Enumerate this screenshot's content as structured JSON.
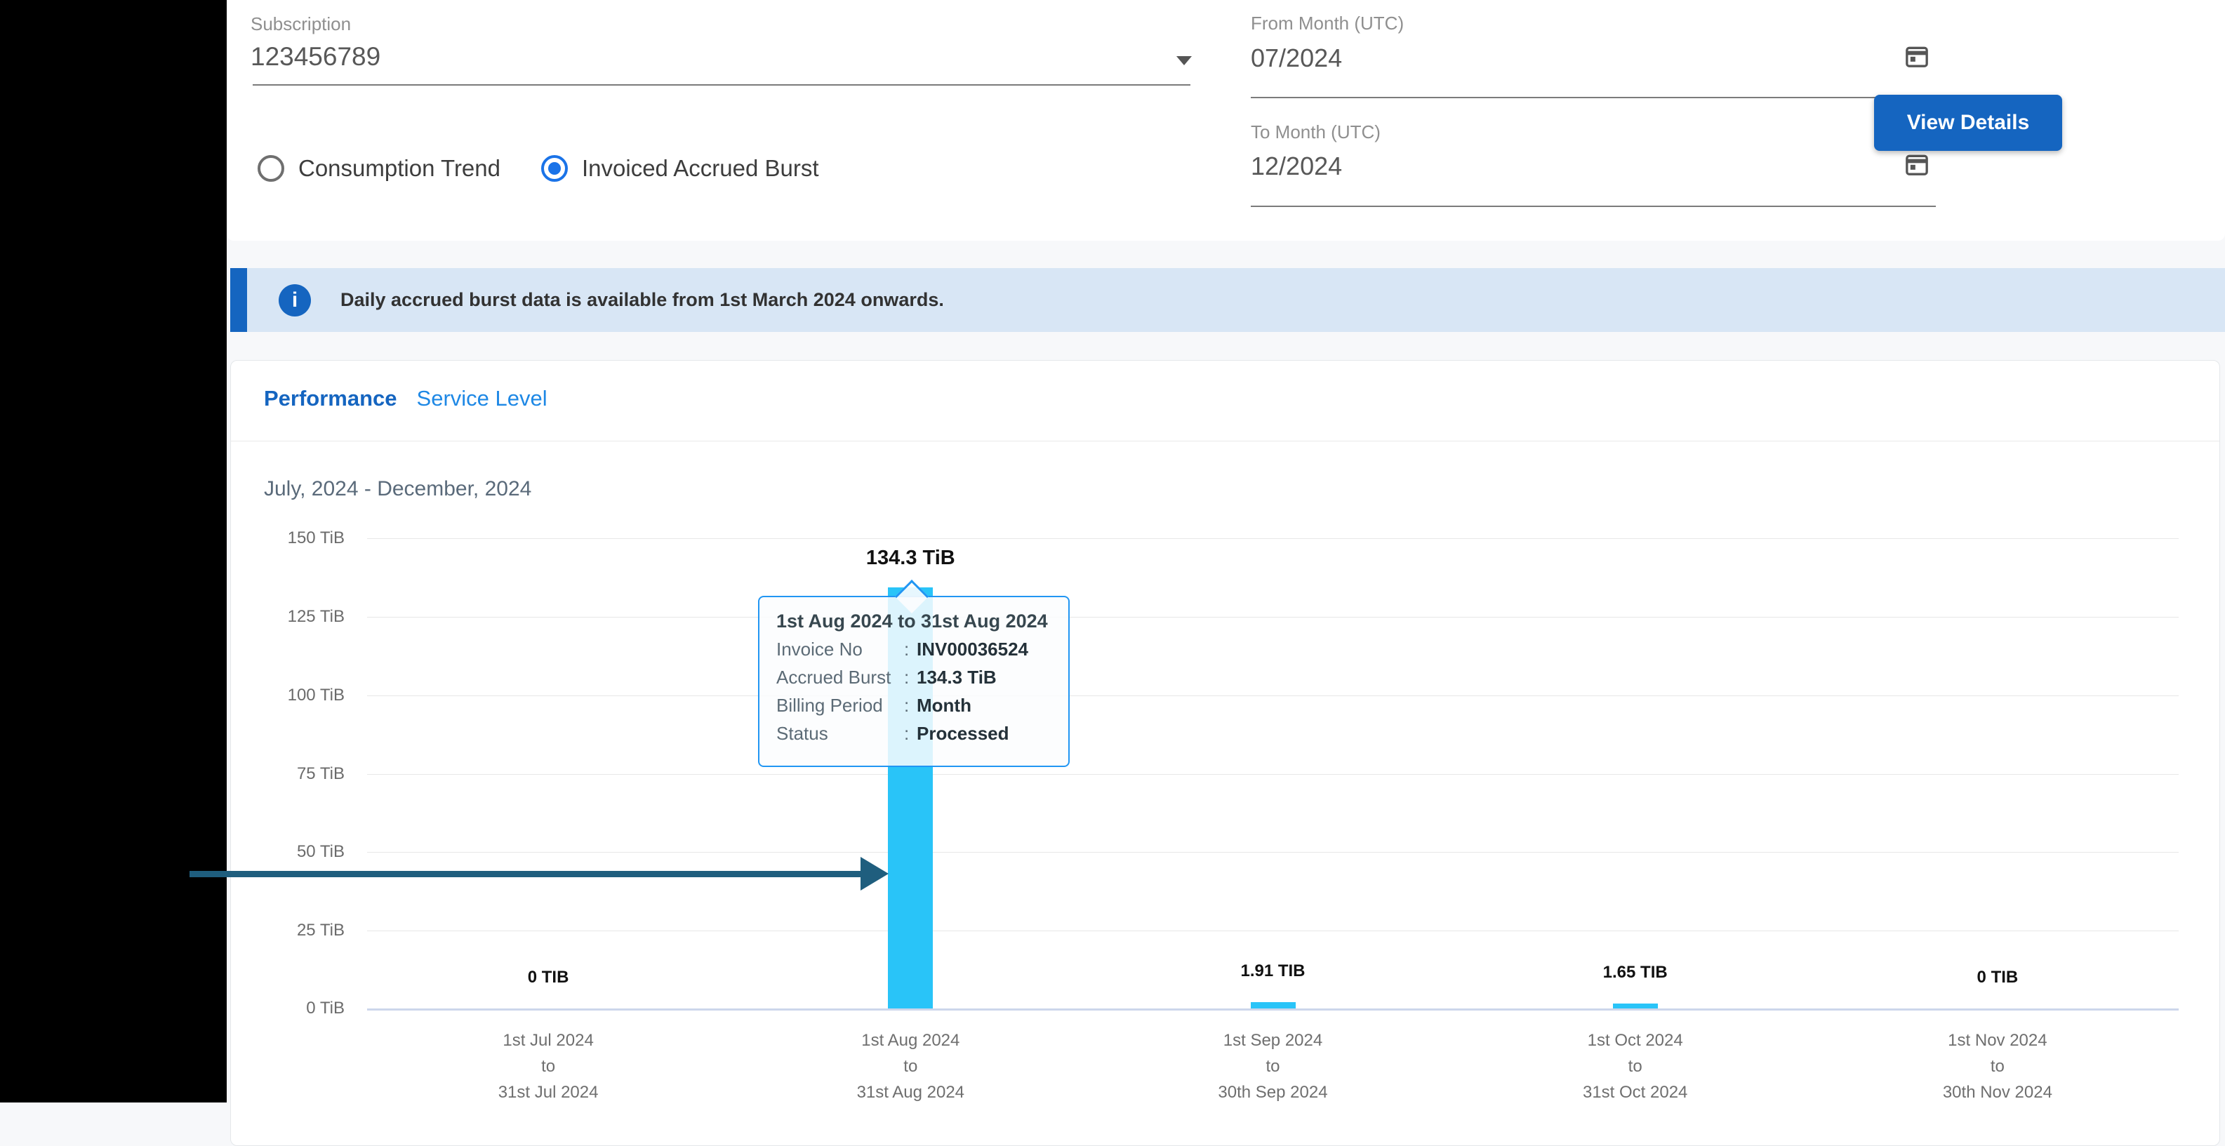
{
  "filters": {
    "subscription": {
      "label": "Subscription",
      "value": "123456789",
      "icon": "dropdown-arrow-icon"
    },
    "view_options": [
      {
        "label": "Consumption Trend",
        "selected": false
      },
      {
        "label": "Invoiced Accrued Burst",
        "selected": true
      }
    ],
    "from_month": {
      "label": "From Month (UTC)",
      "value": "07/2024",
      "icon": "calendar-icon"
    },
    "to_month": {
      "label": "To Month (UTC)",
      "value": "12/2024",
      "icon": "calendar-icon"
    },
    "view_details_label": "View Details"
  },
  "banner": {
    "icon": "info-icon",
    "text": "Daily accrued burst data is available from 1st March 2024 onwards."
  },
  "tabs": [
    {
      "label": "Performance",
      "active": true
    },
    {
      "label": "Service Level",
      "active": false
    }
  ],
  "chart_data": {
    "type": "bar",
    "title": "July, 2024 - December, 2024",
    "unit": "TiB",
    "ylim": [
      0,
      150
    ],
    "ytick_step": 25,
    "yticks": [
      "150 TiB",
      "125 TiB",
      "100 TiB",
      "75 TiB",
      "50 TiB",
      "25 TiB",
      "0 TiB"
    ],
    "categories": [
      [
        "1st Jul 2024",
        "to",
        "31st Jul 2024"
      ],
      [
        "1st Aug 2024",
        "to",
        "31st Aug 2024"
      ],
      [
        "1st Sep 2024",
        "to",
        "30th Sep 2024"
      ],
      [
        "1st Oct 2024",
        "to",
        "31st Oct 2024"
      ],
      [
        "1st Nov 2024",
        "to",
        "30th Nov 2024"
      ]
    ],
    "values": [
      0,
      134.3,
      1.91,
      1.65,
      0
    ],
    "bar_labels": [
      "0 TIB",
      "134.3 TiB",
      "1.91 TIB",
      "1.65 TIB",
      "0 TIB"
    ],
    "bar_color": "#29c4f8",
    "grid": "horizontal",
    "legend": "none"
  },
  "tooltip": {
    "title": "1st Aug 2024 to 31st Aug 2024",
    "rows": [
      {
        "label": "Invoice No",
        "value": "INV00036524"
      },
      {
        "label": "Accrued Burst",
        "value": "134.3 TiB"
      },
      {
        "label": "Billing Period",
        "value": "Month"
      },
      {
        "label": "Status",
        "value": "Processed"
      }
    ]
  },
  "annotation": {
    "type": "arrow",
    "color": "#1f5e7e",
    "points_to": "1st Aug 2024 bar"
  },
  "colors": {
    "accent_blue": "#1565c0",
    "radio_blue": "#1a73e8",
    "banner_bg": "#d8e6f5",
    "bar_cyan": "#29c4f8",
    "tooltip_border": "#2196f3",
    "axis_line": "#ccd6eb",
    "sidebar": "#000000"
  }
}
